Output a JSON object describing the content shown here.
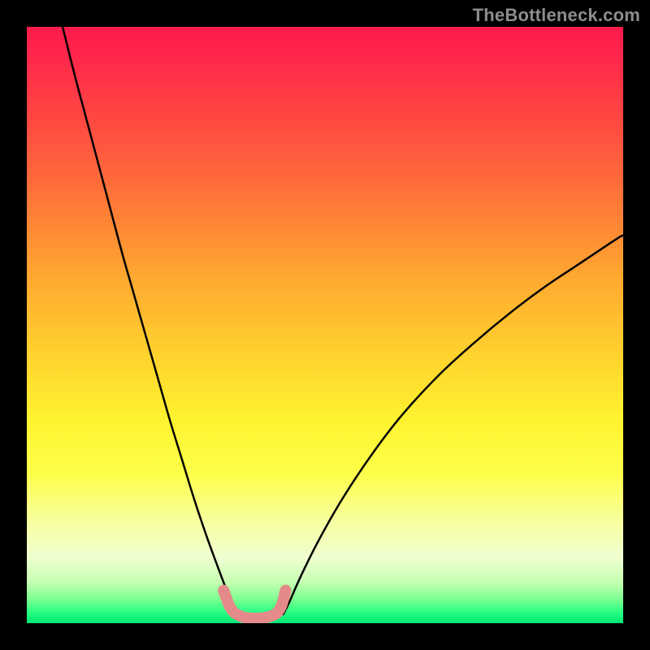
{
  "watermark": "TheBottleneck.com",
  "colors": {
    "background": "#000000",
    "curve_stroke": "#000000",
    "accent_stroke": "#e58a8a"
  },
  "chart_data": {
    "type": "line",
    "title": "",
    "xlabel": "",
    "ylabel": "",
    "xlim": [
      0,
      100
    ],
    "ylim": [
      0,
      100
    ],
    "grid": false,
    "legend": false,
    "annotations": [],
    "series": [
      {
        "name": "left-curve",
        "x": [
          6,
          8,
          10,
          12,
          14,
          16,
          18,
          20,
          22,
          24,
          26,
          28,
          30,
          32,
          33.5,
          34.5,
          35
        ],
        "y": [
          100,
          92,
          84.5,
          77,
          69.5,
          62,
          55,
          48,
          41,
          34,
          27.5,
          21,
          15,
          9.5,
          5.5,
          3,
          1.5
        ]
      },
      {
        "name": "right-curve",
        "x": [
          43,
          44,
          46,
          49,
          53,
          58,
          63,
          69,
          75,
          81,
          87,
          93,
          99,
          100
        ],
        "y": [
          1.5,
          3.5,
          8,
          14,
          21,
          28.5,
          35,
          41.5,
          47,
          52,
          56.5,
          60.5,
          64.5,
          65
        ]
      },
      {
        "name": "valley-accent",
        "x": [
          33,
          34.2,
          35.8,
          38,
          41,
          42.5,
          43.4
        ],
        "y": [
          5.5,
          2.5,
          1.2,
          0.8,
          1.2,
          2.5,
          5.5
        ]
      }
    ]
  }
}
